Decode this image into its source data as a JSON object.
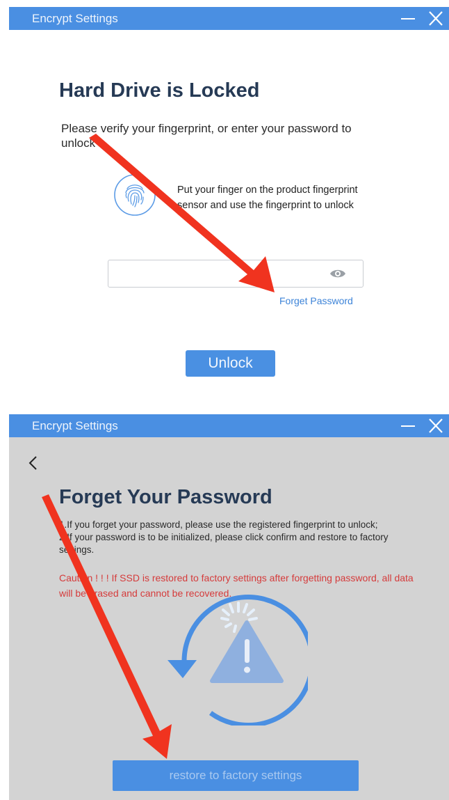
{
  "panel1": {
    "window_title": "Encrypt Settings",
    "heading": "Hard Drive is Locked",
    "description": "Please verify your fingerprint, or enter your password to unlock",
    "fingerprint_text": "Put your finger on the product fingerprint sensor and use the fingerprint to unlock",
    "password_value": "",
    "password_placeholder": "",
    "forget_password_label": "Forget Password",
    "unlock_label": "Unlock"
  },
  "panel2": {
    "window_title": "Encrypt Settings",
    "heading": "Forget Your Password",
    "step1": "1.If you forget your password, please use the registered fingerprint to unlock;",
    "step2": "2.If your password is to be initialized, please click confirm and restore to factory settings.",
    "caution": "Caution ! ! !  If SSD is restored to factory settings after forgetting password, all data will be erased and cannot be recovered.",
    "restore_label": "restore to factory settings"
  },
  "icons": {
    "minimize": "minimize-icon",
    "close": "close-icon",
    "fingerprint": "fingerprint-icon",
    "eye": "eye-icon",
    "back": "chevron-left-icon",
    "restore": "restore-warning-icon",
    "annotation": "red-arrow-annotation"
  },
  "colors": {
    "titlebar": "#4a8fe2",
    "accent": "#4a90e2",
    "heading": "#263a55",
    "link": "#3c83d8",
    "caution": "#d53b3b",
    "annotation": "#f0331f"
  }
}
